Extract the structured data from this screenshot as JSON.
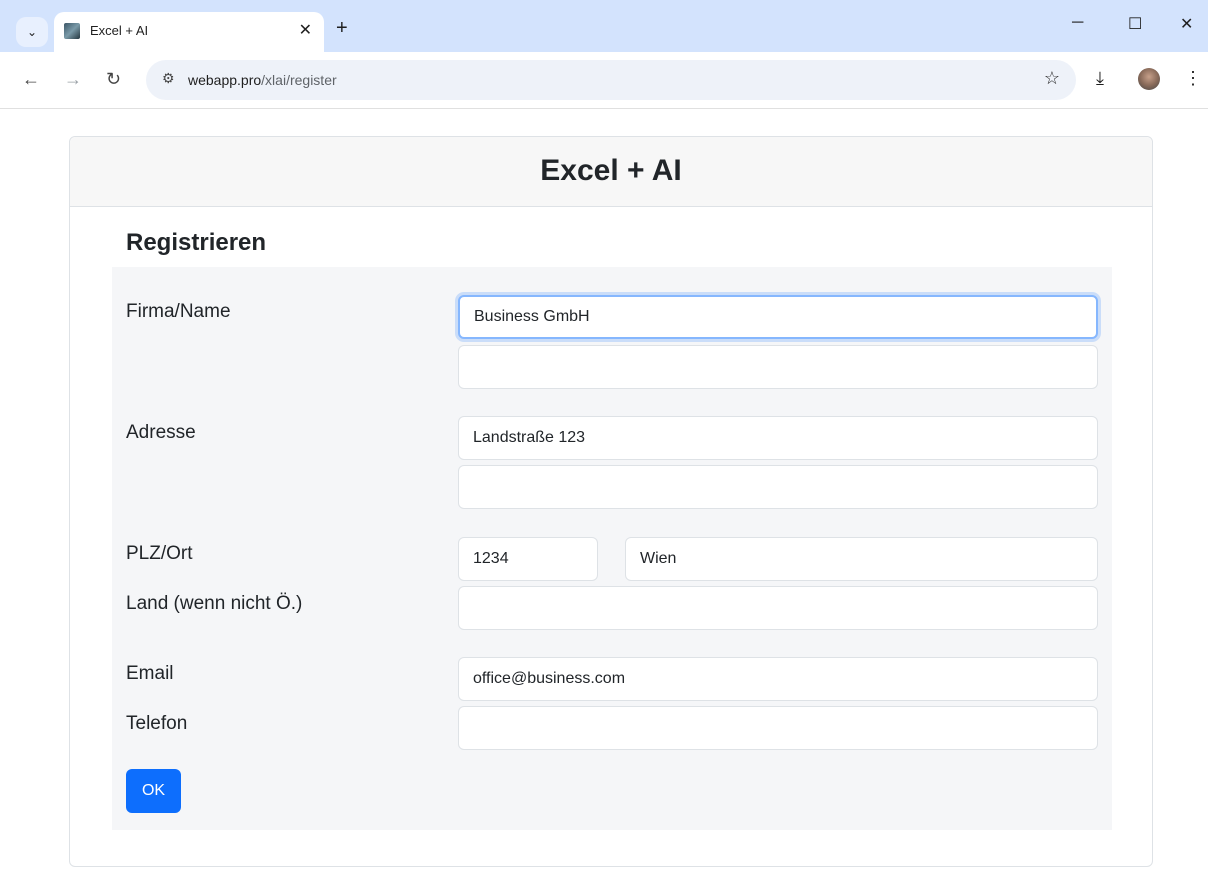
{
  "browser": {
    "tab_title": "Excel + AI",
    "tab_close": "✕",
    "new_tab": "+",
    "url_host": "webapp.pro",
    "url_path": "/xlai/register",
    "minimize": "─",
    "maximize": "☐",
    "close": "✕"
  },
  "page": {
    "app_title": "Excel + AI",
    "section_title": "Registrieren"
  },
  "form": {
    "labels": {
      "name": "Firma/Name",
      "address": "Adresse",
      "zip_city": "PLZ/Ort",
      "country": "Land (wenn nicht Ö.)",
      "email": "Email",
      "phone": "Telefon"
    },
    "values": {
      "name1": "Business GmbH",
      "name2": "",
      "address1": "Landstraße 123",
      "address2": "",
      "zip": "1234",
      "city": "Wien",
      "country": "",
      "email": "office@business.com",
      "phone": ""
    },
    "submit_label": "OK"
  },
  "colors": {
    "accent": "#0d6efd",
    "focus_ring": "#86b7fe",
    "form_background": "#f5f6f8",
    "tabbar": "#d3e3fd"
  }
}
